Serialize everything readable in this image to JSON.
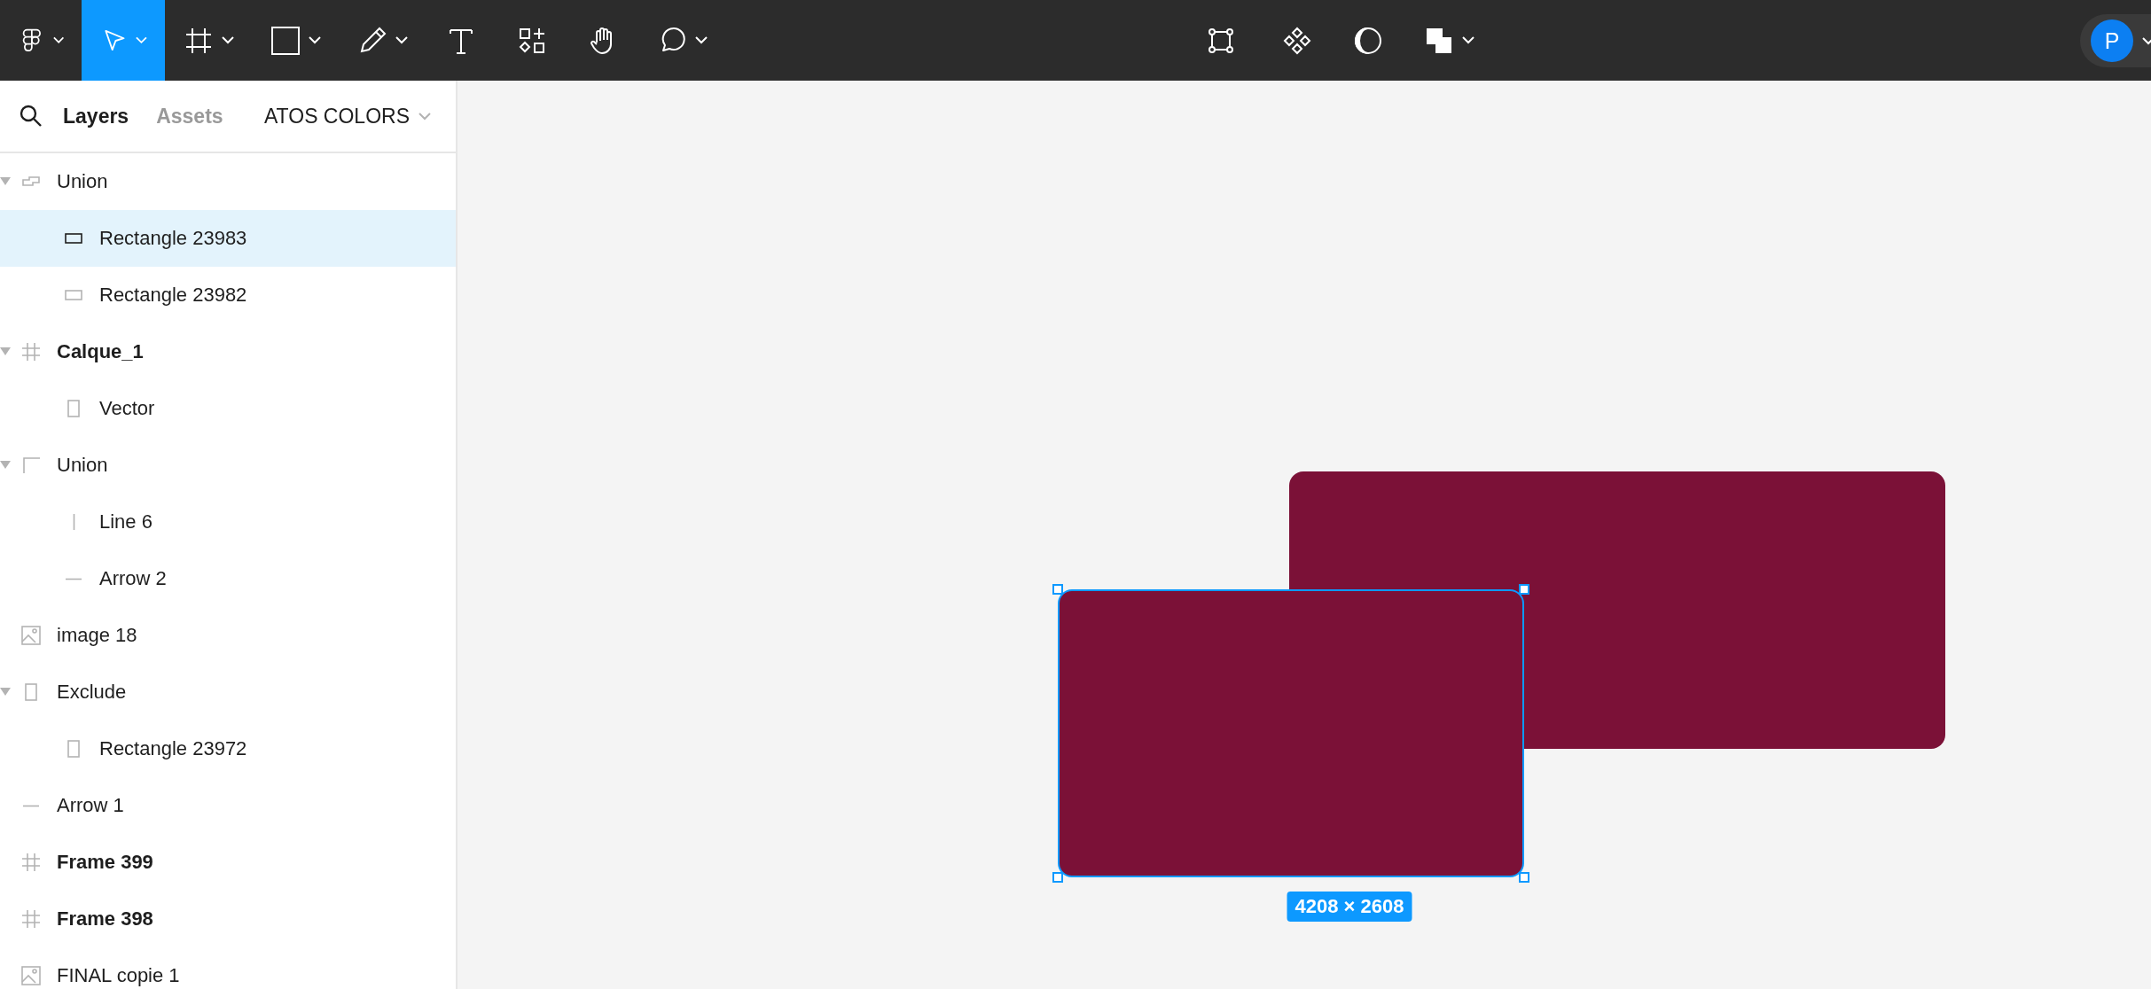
{
  "toolbar": {
    "left_tools": [
      {
        "kind": "main-menu",
        "selected": false,
        "dropdown": true
      },
      {
        "kind": "move",
        "selected": true,
        "dropdown": true
      },
      {
        "kind": "frame",
        "selected": false,
        "dropdown": true
      },
      {
        "kind": "shape",
        "selected": false,
        "dropdown": true
      },
      {
        "kind": "pen",
        "selected": false,
        "dropdown": true
      },
      {
        "kind": "text",
        "selected": false,
        "dropdown": false
      },
      {
        "kind": "resources",
        "selected": false,
        "dropdown": false
      },
      {
        "kind": "hand",
        "selected": false,
        "dropdown": false
      },
      {
        "kind": "comment",
        "selected": false,
        "dropdown": true
      }
    ],
    "center_tools": [
      {
        "kind": "edit-object",
        "dropdown": false
      },
      {
        "kind": "component",
        "dropdown": false
      },
      {
        "kind": "mask",
        "dropdown": false
      },
      {
        "kind": "boolean",
        "dropdown": true
      }
    ],
    "avatar": "P"
  },
  "panel": {
    "tabs": [
      {
        "label": "Layers",
        "selected": true
      },
      {
        "label": "Assets",
        "selected": false
      }
    ],
    "page": "ATOS COLORS"
  },
  "layers": [
    {
      "name": "Union",
      "kind": "union",
      "expanded": true,
      "selected": false,
      "children": [
        {
          "name": "Rectangle 23983",
          "kind": "rectangle",
          "selected": true
        },
        {
          "name": "Rectangle 23982",
          "kind": "rectangle",
          "selected": false
        }
      ]
    },
    {
      "name": "Calque_1",
      "kind": "frame",
      "expanded": true,
      "selected": false,
      "children": [
        {
          "name": "Vector",
          "kind": "vector",
          "selected": false
        }
      ]
    },
    {
      "name": "Union",
      "kind": "corner",
      "expanded": true,
      "selected": false,
      "children": [
        {
          "name": "Line 6",
          "kind": "line",
          "selected": false
        },
        {
          "name": "Arrow 2",
          "kind": "arrow",
          "selected": false
        }
      ]
    },
    {
      "name": "image 18",
      "kind": "image",
      "selected": false
    },
    {
      "name": "Exclude",
      "kind": "vector",
      "expanded": true,
      "selected": false,
      "children": [
        {
          "name": "Rectangle 23972",
          "kind": "vector",
          "selected": false
        }
      ]
    },
    {
      "name": "Arrow 1",
      "kind": "arrow",
      "selected": false
    },
    {
      "name": "Frame 399",
      "kind": "frame",
      "selected": false
    },
    {
      "name": "Frame 398",
      "kind": "frame",
      "selected": false
    },
    {
      "name": "FINAL copie 1",
      "kind": "image",
      "selected": false
    }
  ],
  "canvas": {
    "shapes": [
      {
        "selected": false
      },
      {
        "selected": true
      }
    ],
    "size_label": "4208 × 2608"
  }
}
